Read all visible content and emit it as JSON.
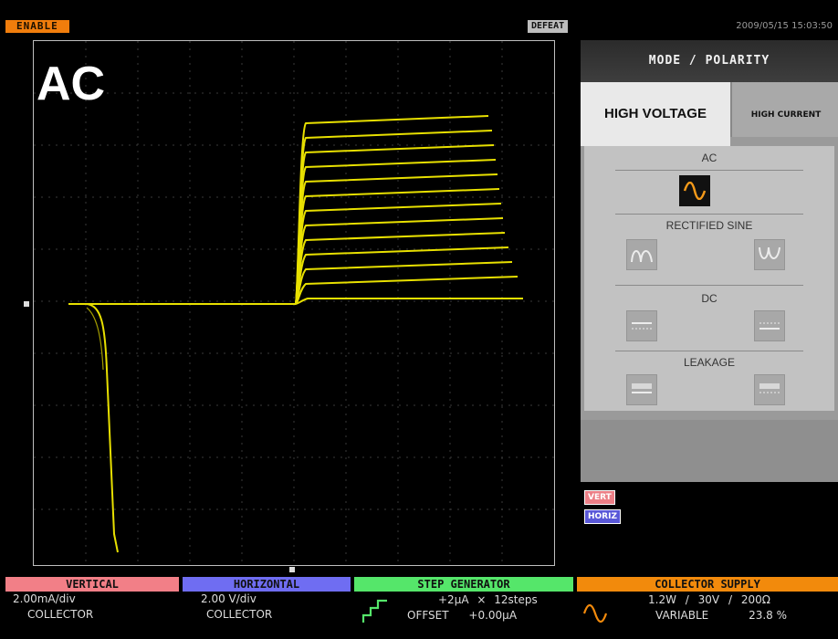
{
  "top": {
    "enable": "ENABLE",
    "defeat": "DEFEAT",
    "datetime": "2009/05/15 15:03:50"
  },
  "display": {
    "mode": "AC",
    "trace_color": "#e8e000"
  },
  "panel": {
    "title": "MODE / POLARITY",
    "tabs": [
      "HIGH VOLTAGE",
      "HIGH CURRENT"
    ],
    "sections": {
      "ac": "AC",
      "rectified": "RECTIFIED SINE",
      "dc": "DC",
      "leakage": "LEAKAGE"
    },
    "icons": [
      "ac-sine-icon",
      "rectified-positive-icon",
      "rectified-negative-icon",
      "dc-positive-icon",
      "dc-negative-icon",
      "leakage-positive-icon",
      "leakage-negative-icon"
    ]
  },
  "legend": {
    "vert": "VERT",
    "horiz": "HORIZ"
  },
  "status": {
    "vertical": {
      "label": "VERTICAL",
      "color": "#f27f87",
      "scale": "2.00mA/div",
      "source": "COLLECTOR"
    },
    "horizontal": {
      "label": "HORIZONTAL",
      "color": "#6f6df2",
      "scale": "2.00 V/div",
      "source": "COLLECTOR"
    },
    "step": {
      "label": "STEP GENERATOR",
      "color": "#55e66a",
      "step_value": "+2µA",
      "times": "×",
      "steps": "12steps",
      "offset_label": "OFFSET",
      "offset_value": "+0.00µA"
    },
    "collector": {
      "label": "COLLECTOR SUPPLY",
      "color": "#f28a0c",
      "power": "1.2W",
      "voltage": "30V",
      "resistance": "200Ω",
      "slash": "/",
      "mode": "VARIABLE",
      "percent": "23.8 %"
    }
  }
}
